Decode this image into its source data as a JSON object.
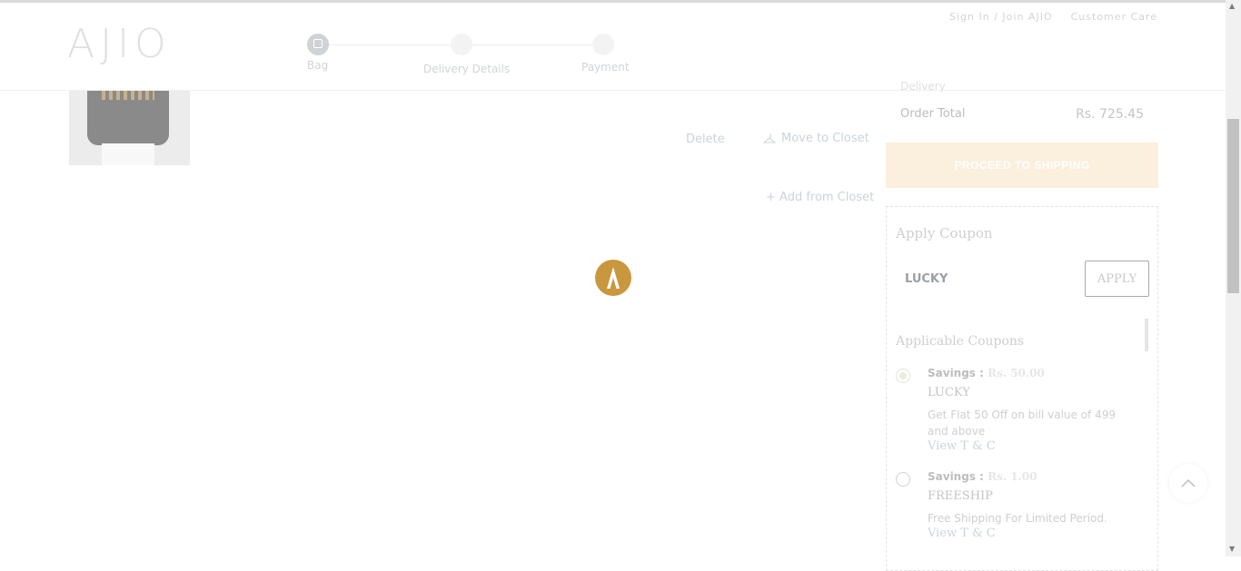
{
  "header": {
    "logo": "AJIO",
    "sign_in": "Sign In / Join AJIO",
    "customer_care": "Customer Care",
    "steps": [
      "Bag",
      "Delivery Details",
      "Payment"
    ]
  },
  "cart_item": {
    "delete_label": "Delete",
    "move_label": "Move to Closet"
  },
  "add_from_closet": "+ Add from Closet",
  "summary": {
    "partial_label": "Delivery",
    "order_total_label": "Order Total",
    "order_total_value": "Rs. 725.45",
    "proceed_label": "PROCEED TO SHIPPING"
  },
  "coupon": {
    "title": "Apply Coupon",
    "input_value": "LUCKY",
    "apply_label": "APPLY",
    "applicable_title": "Applicable Coupons",
    "items": [
      {
        "savings_label": "Savings :",
        "savings_value": "Rs. 50.00",
        "code": "LUCKY",
        "desc": "Get Flat 50 Off on bill value of 499 and above",
        "tc": "View T & C",
        "selected": true
      },
      {
        "savings_label": "Savings :",
        "savings_value": "Rs. 1.00",
        "code": "FREESHIP",
        "desc": "Free Shipping For Limited Period.",
        "tc": "View T & C",
        "selected": false
      }
    ]
  },
  "colors": {
    "loader": "#c9973e",
    "proceed_bg": "#fbefdd",
    "muted_text": "#d1d4d8"
  }
}
